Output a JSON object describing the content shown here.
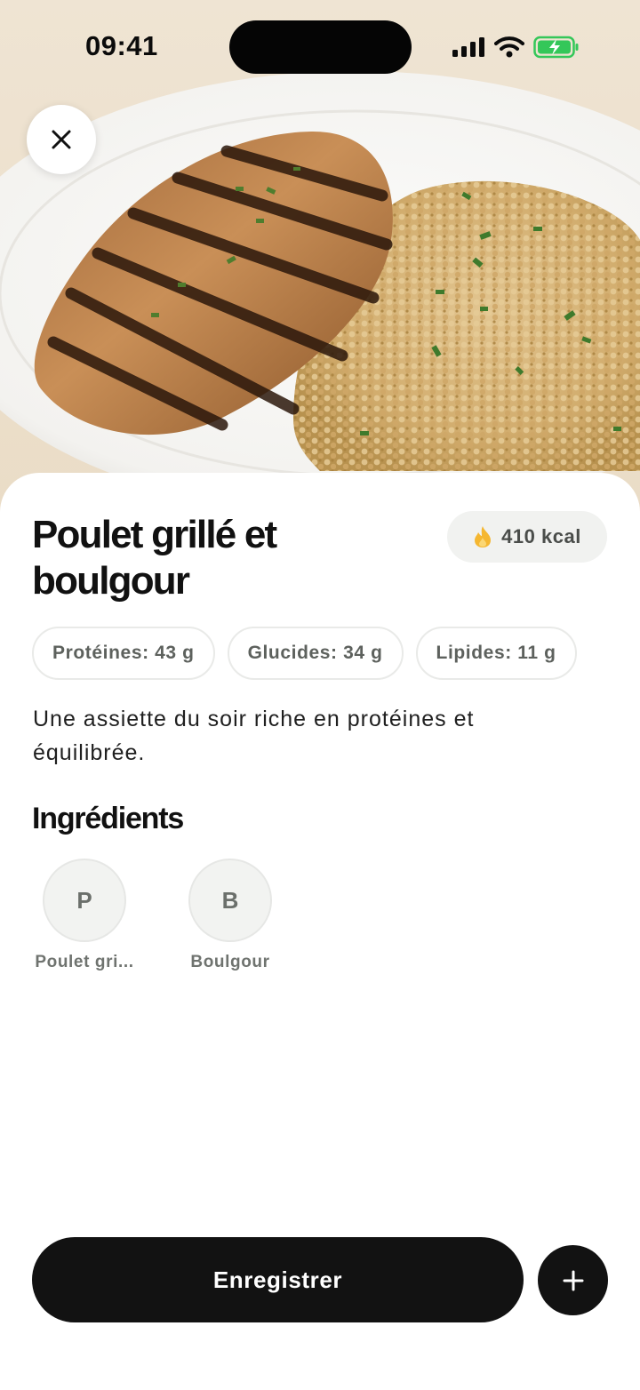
{
  "status_bar": {
    "time": "09:41",
    "battery_color": "#34c759"
  },
  "hero": {
    "image_description_icon": "meal-photo"
  },
  "header": {
    "close_icon": "close-icon"
  },
  "meal": {
    "title": "Poulet grillé et boulgour",
    "kcal": "410 kcal",
    "kcal_icon": "flame-icon",
    "kcal_icon_color": "#f5b731",
    "macros": [
      {
        "label": "Protéines: 43 g"
      },
      {
        "label": "Glucides: 34 g"
      },
      {
        "label": "Lipides: 11 g"
      }
    ],
    "description": "Une assiette du soir riche en protéines et équilibrée."
  },
  "ingredients_section": {
    "title": "Ingrédients",
    "items": [
      {
        "initial": "P",
        "label": "Poulet gri..."
      },
      {
        "initial": "B",
        "label": "Boulgour"
      }
    ]
  },
  "actions": {
    "save_label": "Enregistrer",
    "add_icon": "plus-icon",
    "primary_color": "#121212"
  }
}
